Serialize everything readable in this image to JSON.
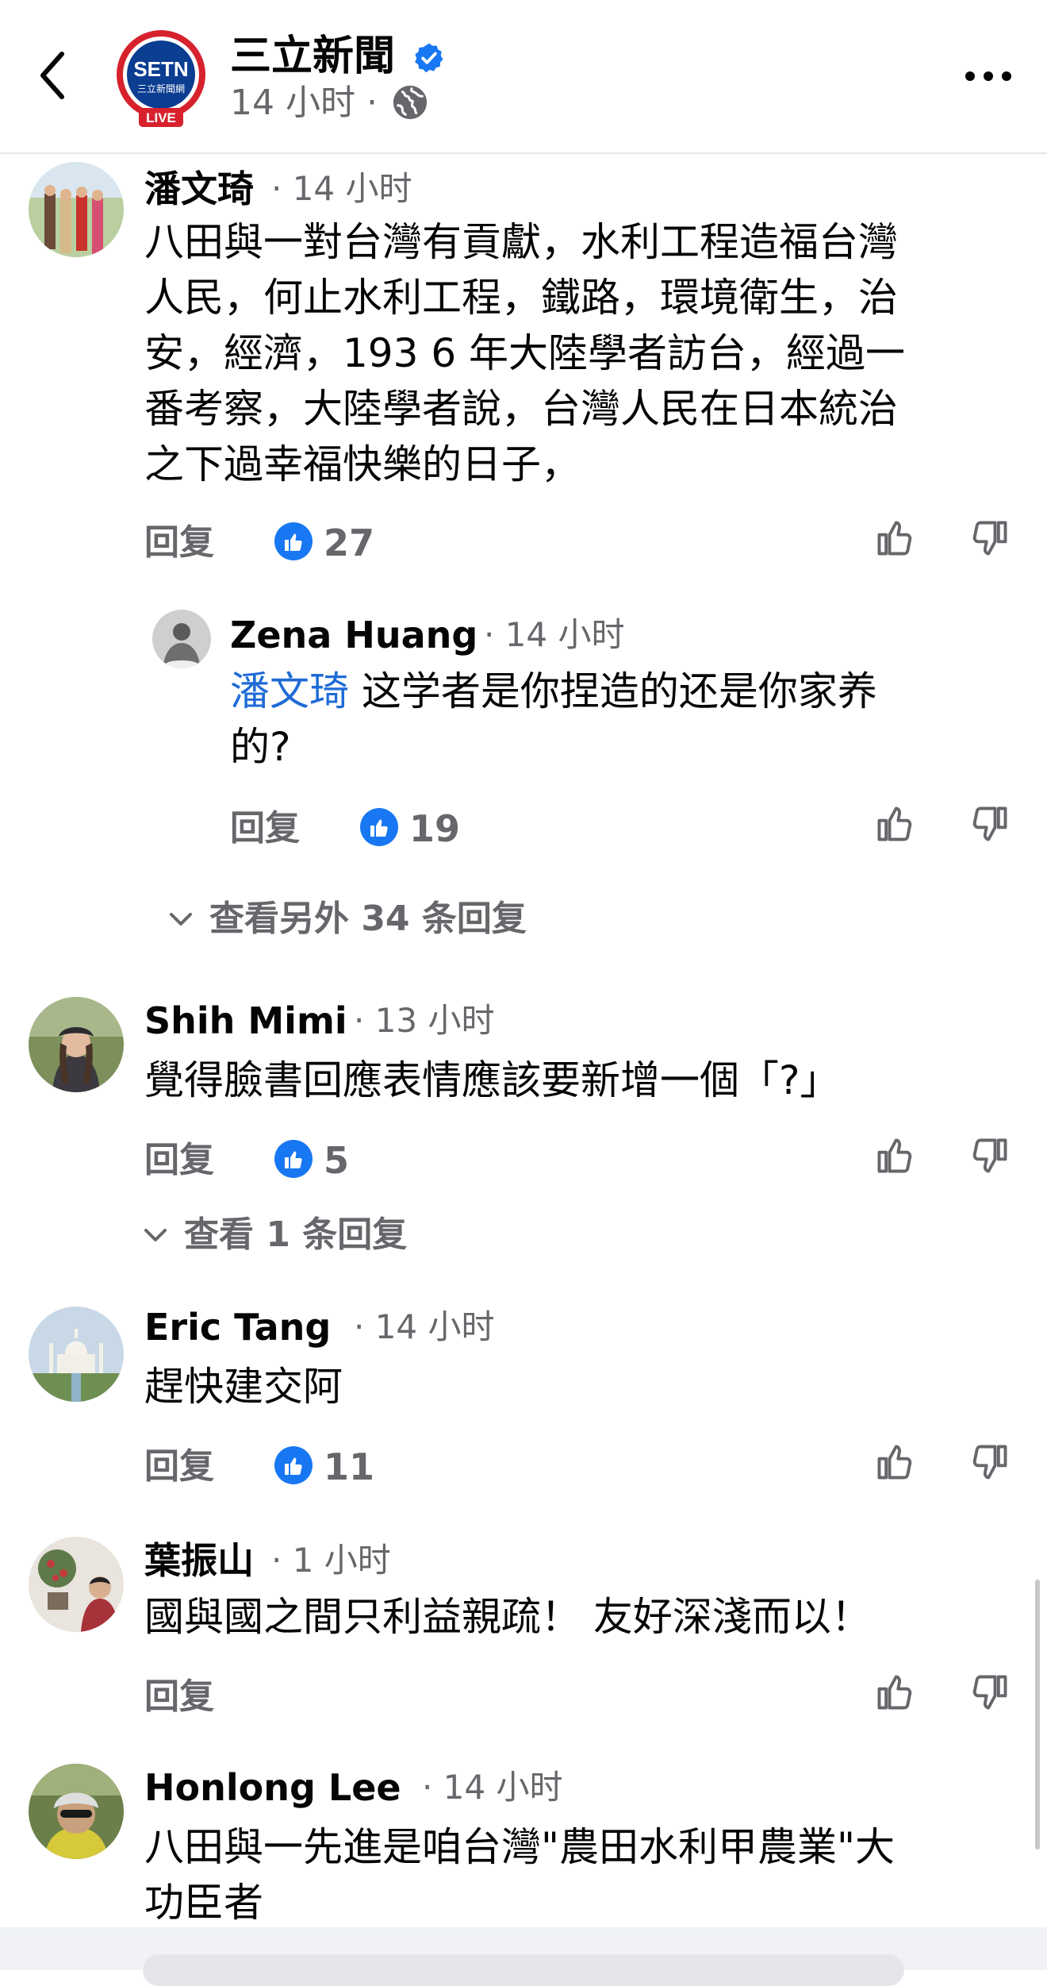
{
  "header": {
    "page_name": "三立新聞",
    "time": "14 小时 ·",
    "logo_text": "SETN",
    "logo_sub": "三立新聞網",
    "logo_live": "LIVE"
  },
  "colors": {
    "accent": "#1877f2",
    "mention": "#1f6bd6",
    "muted": "#65676b"
  },
  "comments": [
    {
      "name": "潘文琦",
      "time": "· 14 小时",
      "text_lines": [
        "八田與一對台灣有貢獻，水利工程造福台灣",
        "人民，何止水利工程，鐵路，環境衛生，治",
        "安，經濟，193 6 年大陸學者訪台，經過一",
        "番考察，大陸學者說，台灣人民在日本統治",
        "之下過幸福快樂的日子，"
      ],
      "reply_label": "回复",
      "likes": "27",
      "replies": [
        {
          "name": "Zena Huang",
          "time": "· 14 小时",
          "mention": "潘文琦",
          "text_line1": " 这学者是你捏造的还是你家养",
          "text_line2": "的?",
          "reply_label": "回复",
          "likes": "19"
        }
      ],
      "more_replies": "查看另外 34 条回复"
    },
    {
      "name": "Shih Mimi",
      "time": "· 13 小时",
      "text_lines": [
        "覺得臉書回應表情應該要新增一個「?」"
      ],
      "reply_label": "回复",
      "likes": "5",
      "more_replies": "查看 1 条回复"
    },
    {
      "name": "Eric  Tang",
      "time": "· 14 小时",
      "text_lines": [
        "趕快建交阿"
      ],
      "reply_label": "回复",
      "likes": "11"
    },
    {
      "name": "葉振山",
      "time": "· 1 小时",
      "text_lines": [
        "國與國之間只利益親疏！ 友好深淺而以！"
      ],
      "reply_label": "回复"
    },
    {
      "name": "Honlong Lee",
      "time": "· 14 小时",
      "text_lines": [
        "八田與一先進是咱台灣\"農田水利甲農業\"大",
        "功臣者"
      ]
    }
  ]
}
